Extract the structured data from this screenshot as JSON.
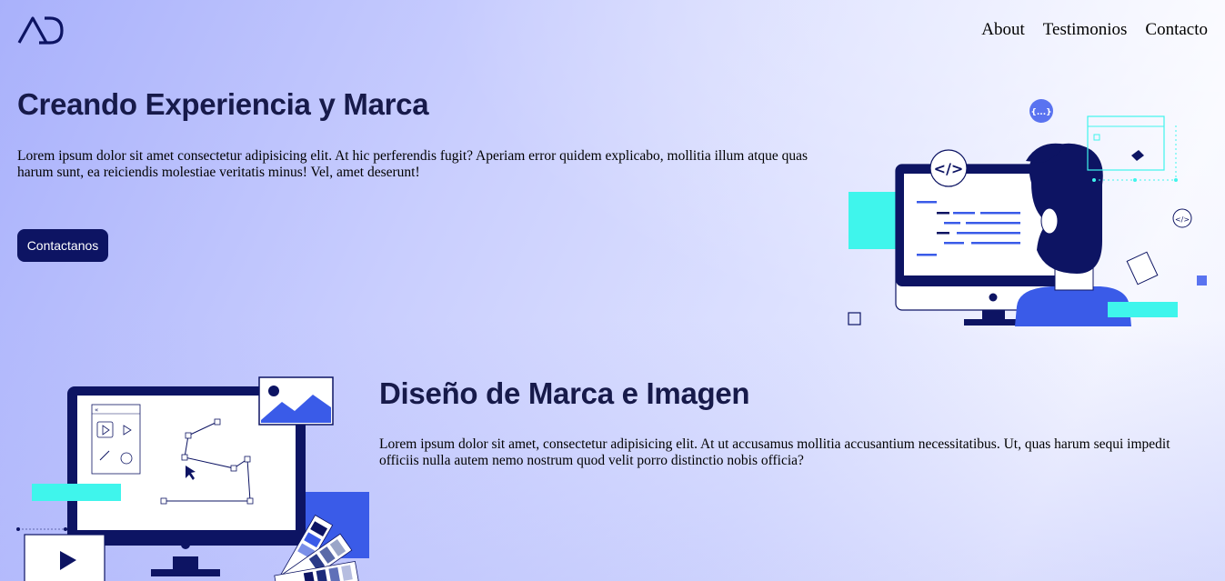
{
  "header": {
    "logo_alt": "AD",
    "nav": [
      {
        "label": "About"
      },
      {
        "label": "Testimonios"
      },
      {
        "label": "Contacto"
      }
    ]
  },
  "hero": {
    "title": "Creando Experiencia y Marca",
    "text": "Lorem ipsum dolor sit amet consectetur adipisicing elit. At hic perferendis fugit? Aperiam error quidem explicabo, mollitia illum atque quas harum sunt, ea reiciendis molestiae veritatis minus! Vel, amet deserunt!",
    "cta_label": "Contactanos",
    "illustration": {
      "code_tag": "</>",
      "curly_tag": "{...}",
      "small_code_tag": "</>"
    }
  },
  "section_brand": {
    "title": "Diseño de Marca e Imagen",
    "text": "Lorem ipsum dolor sit amet, consectetur adipisicing elit. At ut accusamus mollitia accusantium necessitatibus. Ut, quas harum sequi impedit officiis nulla autem nemo nostrum quod velit porro distinctio nobis officia?",
    "illustration": {
      "panel_label": "«"
    }
  },
  "colors": {
    "navy": "#0d1463",
    "blue": "#3a5be8",
    "cyan": "#3ff5ec",
    "title": "#171a4a"
  }
}
